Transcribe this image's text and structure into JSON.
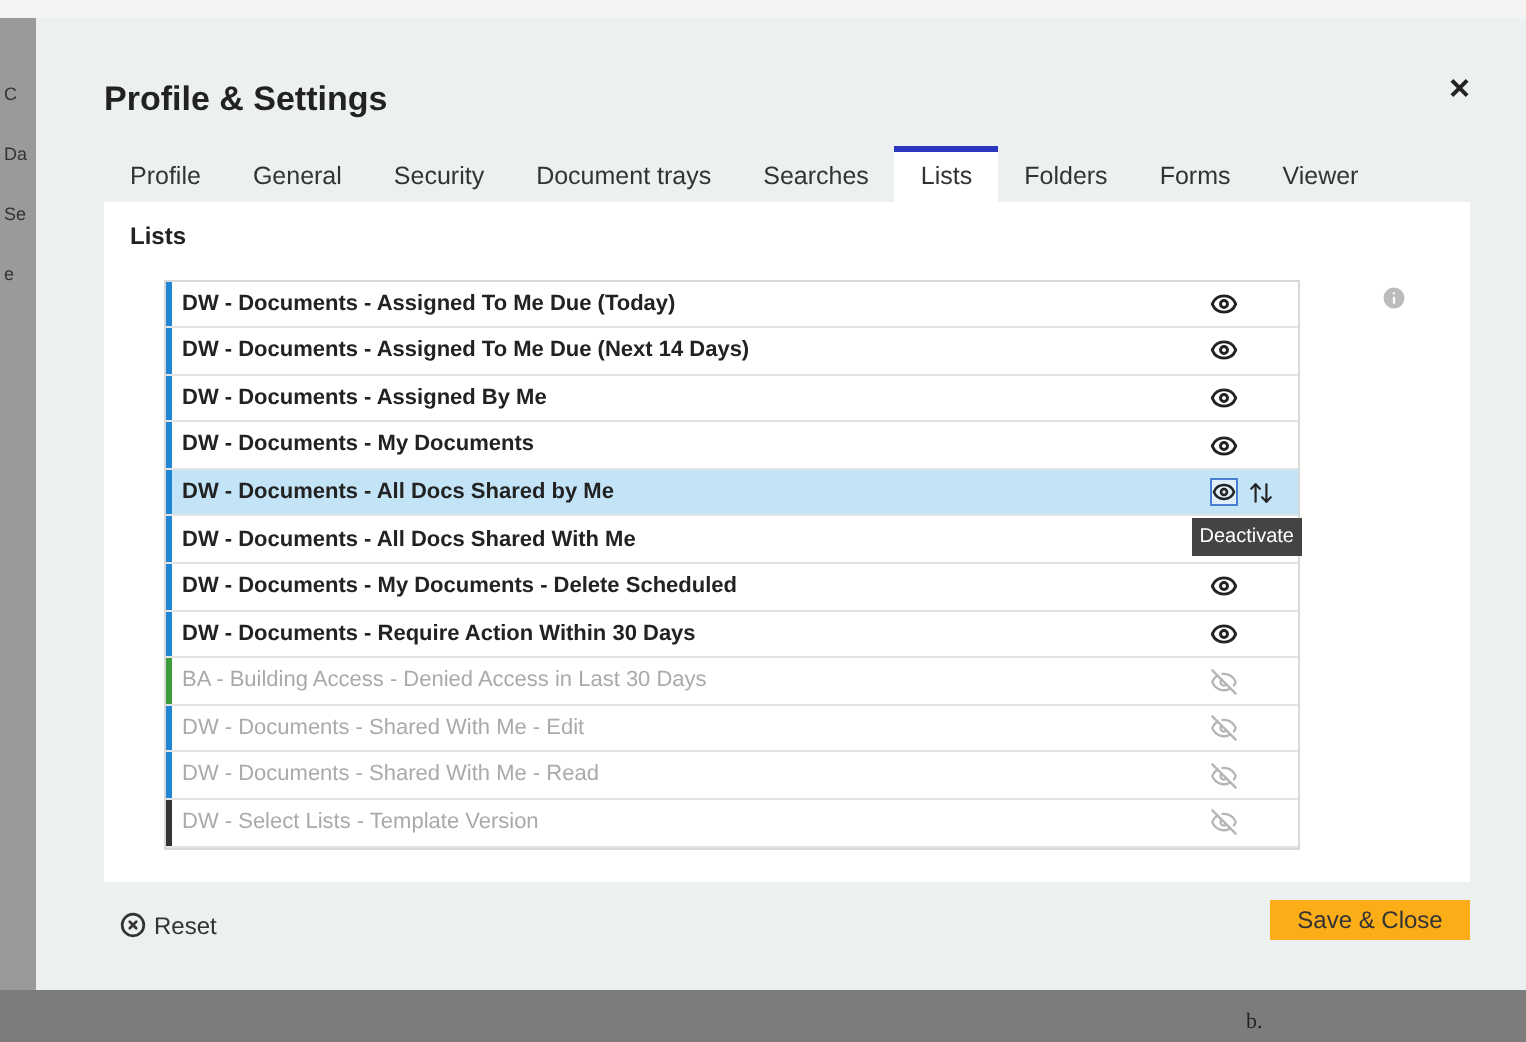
{
  "backdrop": {
    "side_texts": [
      "C",
      "Da",
      "Se",
      "e"
    ],
    "bottom_text": "b."
  },
  "dialog": {
    "title": "Profile & Settings",
    "close": "×"
  },
  "tabs": [
    {
      "label": "Profile",
      "selected": false
    },
    {
      "label": "General",
      "selected": false
    },
    {
      "label": "Security",
      "selected": false
    },
    {
      "label": "Document trays",
      "selected": false
    },
    {
      "label": "Searches",
      "selected": false
    },
    {
      "label": "Lists",
      "selected": true
    },
    {
      "label": "Folders",
      "selected": false
    },
    {
      "label": "Forms",
      "selected": false
    },
    {
      "label": "Viewer",
      "selected": false
    }
  ],
  "section_title": "Lists",
  "lists": [
    {
      "name": "DW - Documents - Assigned To Me Due (Today)",
      "active": true,
      "selected": false,
      "color": "#1f86d6"
    },
    {
      "name": "DW - Documents - Assigned To Me Due (Next 14 Days)",
      "active": true,
      "selected": false,
      "color": "#1f86d6"
    },
    {
      "name": "DW - Documents - Assigned By Me",
      "active": true,
      "selected": false,
      "color": "#1f86d6"
    },
    {
      "name": "DW - Documents - My Documents",
      "active": true,
      "selected": false,
      "color": "#1f86d6"
    },
    {
      "name": "DW - Documents - All Docs Shared by Me",
      "active": true,
      "selected": true,
      "color": "#1f86d6",
      "tooltip": "Deactivate"
    },
    {
      "name": "DW - Documents - All Docs Shared With Me",
      "active": true,
      "selected": false,
      "color": "#1f86d6",
      "icon_covered": true
    },
    {
      "name": "DW - Documents - My Documents - Delete Scheduled",
      "active": true,
      "selected": false,
      "color": "#1f86d6"
    },
    {
      "name": "DW - Documents - Require Action Within 30 Days",
      "active": true,
      "selected": false,
      "color": "#1f86d6"
    },
    {
      "name": "BA - Building Access - Denied Access in Last 30 Days",
      "active": false,
      "selected": false,
      "color": "#3c9c3c"
    },
    {
      "name": "DW - Documents - Shared With Me - Edit",
      "active": false,
      "selected": false,
      "color": "#1f86d6"
    },
    {
      "name": "DW - Documents - Shared With Me - Read",
      "active": false,
      "selected": false,
      "color": "#1f86d6"
    },
    {
      "name": "DW - Select Lists - Template Version",
      "active": false,
      "selected": false,
      "color": "#333333"
    }
  ],
  "footer": {
    "reset": "Reset",
    "save": "Save & Close"
  }
}
